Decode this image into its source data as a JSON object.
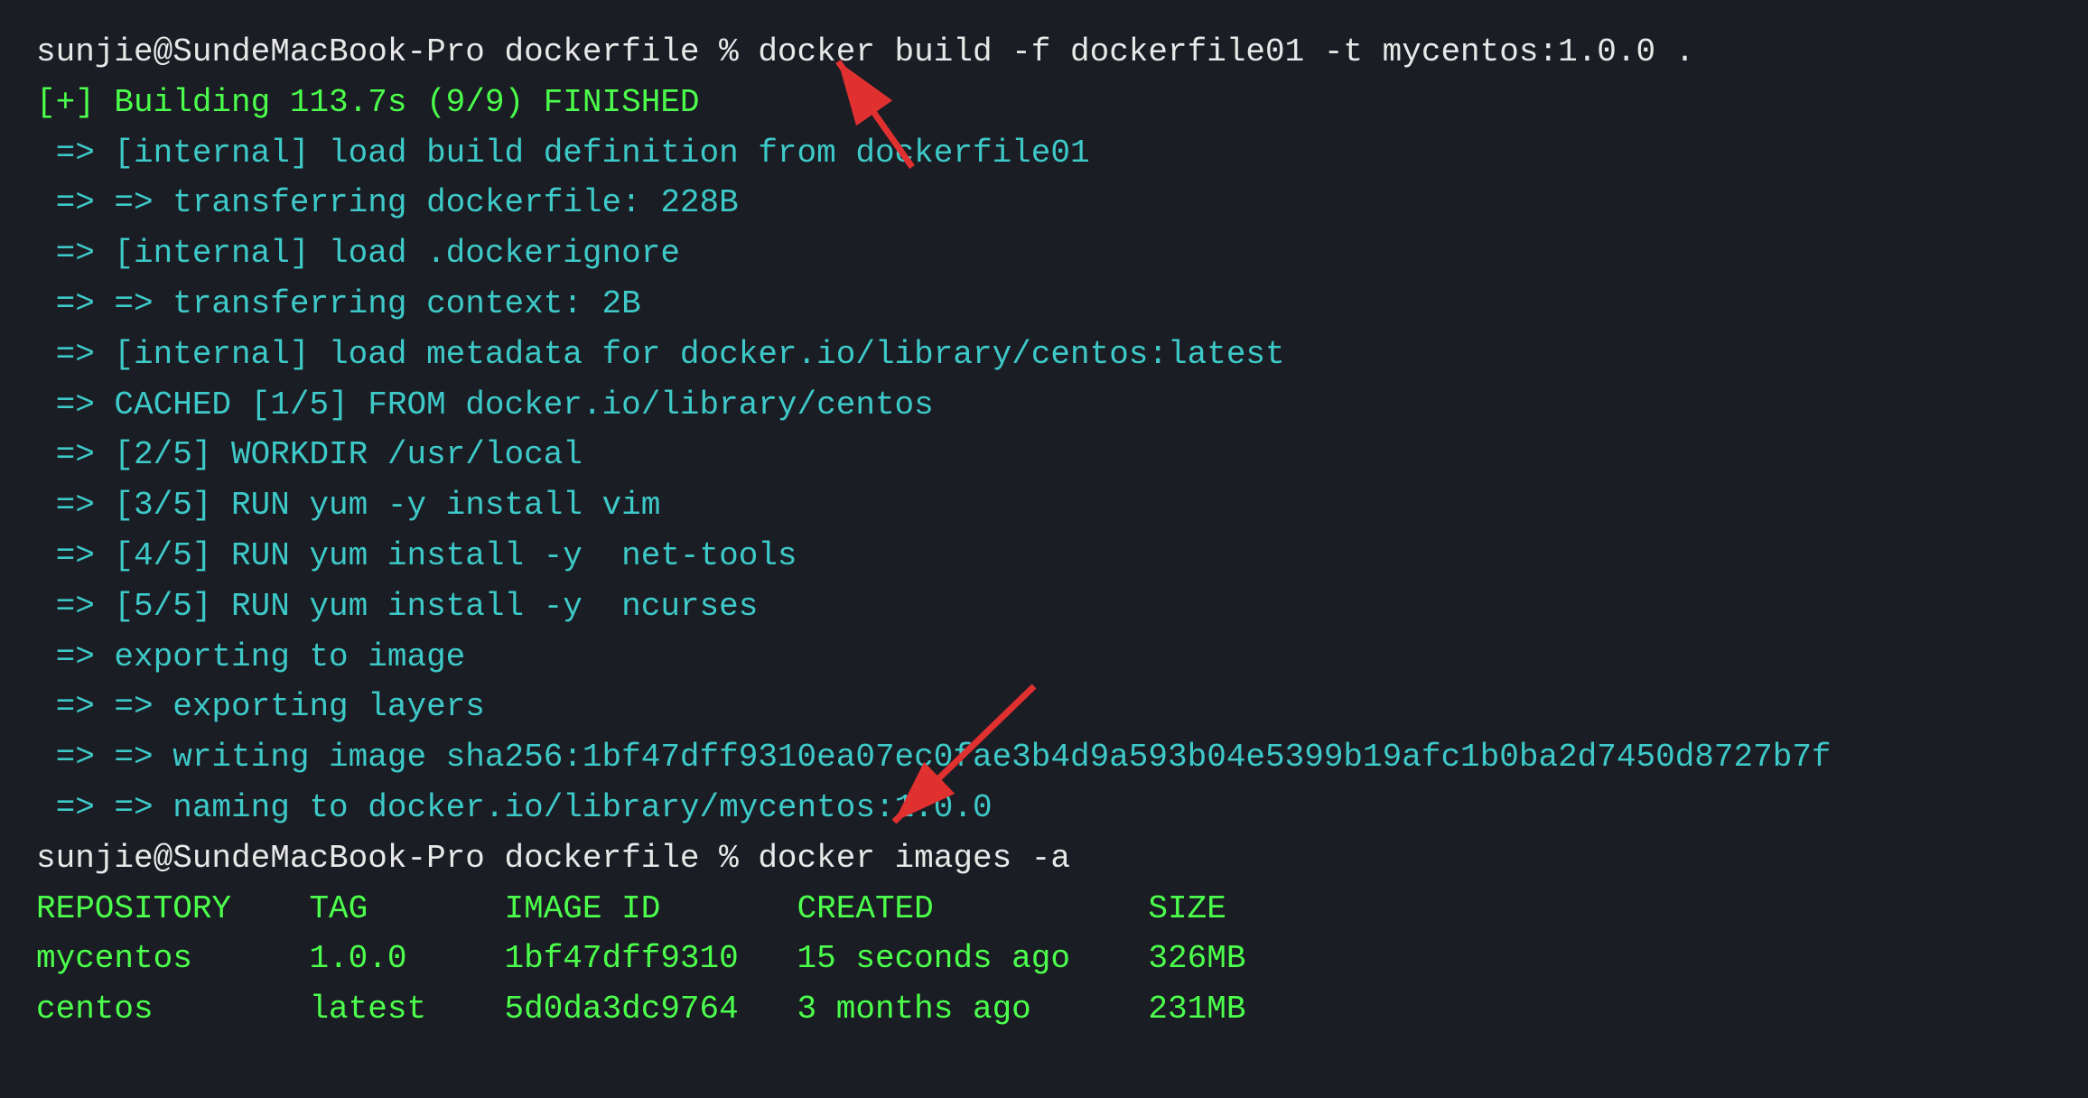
{
  "terminal": {
    "lines": [
      {
        "id": "cmd1",
        "color": "white",
        "text": "sunjie@SundeMacBook-Pro dockerfile % docker build -f dockerfile01 -t mycentos:1.0.0 ."
      },
      {
        "id": "building",
        "color": "green",
        "text": "[+] Building 113.7s (9/9) FINISHED"
      },
      {
        "id": "step1",
        "color": "cyan",
        "text": " => [internal] load build definition from dockerfile01"
      },
      {
        "id": "step2",
        "color": "cyan",
        "text": " => => transferring dockerfile: 228B"
      },
      {
        "id": "step3",
        "color": "cyan",
        "text": " => [internal] load .dockerignore"
      },
      {
        "id": "step4",
        "color": "cyan",
        "text": " => => transferring context: 2B"
      },
      {
        "id": "step5",
        "color": "cyan",
        "text": " => [internal] load metadata for docker.io/library/centos:latest"
      },
      {
        "id": "step6",
        "color": "cyan",
        "text": " => CACHED [1/5] FROM docker.io/library/centos"
      },
      {
        "id": "step7",
        "color": "cyan",
        "text": " => [2/5] WORKDIR /usr/local"
      },
      {
        "id": "step8",
        "color": "cyan",
        "text": " => [3/5] RUN yum -y install vim"
      },
      {
        "id": "step9",
        "color": "cyan",
        "text": " => [4/5] RUN yum install -y  net-tools"
      },
      {
        "id": "step10",
        "color": "cyan",
        "text": " => [5/5] RUN yum install -y  ncurses"
      },
      {
        "id": "step11",
        "color": "cyan",
        "text": " => exporting to image"
      },
      {
        "id": "step12",
        "color": "cyan",
        "text": " => => exporting layers"
      },
      {
        "id": "step13",
        "color": "cyan",
        "text": " => => writing image sha256:1bf47dff9310ea07ec0fae3b4d9a593b04e5399b19afc1b0ba2d7450d8727b7f"
      },
      {
        "id": "step14",
        "color": "cyan",
        "text": " => => naming to docker.io/library/mycentos:1.0.0"
      },
      {
        "id": "cmd2",
        "color": "white",
        "text": "sunjie@SundeMacBook-Pro dockerfile % docker images -a"
      },
      {
        "id": "header",
        "color": "green",
        "text": "REPOSITORY    TAG       IMAGE ID       CREATED           SIZE"
      },
      {
        "id": "row1",
        "color": "green",
        "text": "mycentos      1.0.0     1bf47dff9310   15 seconds ago    326MB"
      },
      {
        "id": "row2",
        "color": "green",
        "text": "centos        latest    5d0da3dc9764   3 months ago      231MB"
      }
    ]
  }
}
